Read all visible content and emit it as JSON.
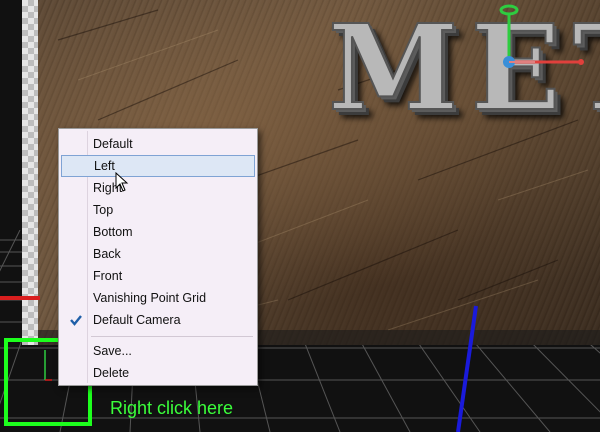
{
  "context_menu": {
    "items": [
      {
        "label": "Default",
        "checked": false,
        "hovered": false
      },
      {
        "label": "Left",
        "checked": false,
        "hovered": true
      },
      {
        "label": "Right",
        "checked": false,
        "hovered": false
      },
      {
        "label": "Top",
        "checked": false,
        "hovered": false
      },
      {
        "label": "Bottom",
        "checked": false,
        "hovered": false
      },
      {
        "label": "Back",
        "checked": false,
        "hovered": false
      },
      {
        "label": "Front",
        "checked": false,
        "hovered": false
      },
      {
        "label": "Vanishing Point Grid",
        "checked": false,
        "hovered": false
      },
      {
        "label": "Default Camera",
        "checked": true,
        "hovered": false
      }
    ],
    "footer_items": [
      {
        "label": "Save..."
      },
      {
        "label": "Delete"
      }
    ]
  },
  "scene": {
    "title_text": "METAL"
  },
  "annotation": {
    "hint": "Right click here",
    "highlight_color": "#1dff1d"
  },
  "colors": {
    "menu_hover_bg": "#dde7f5",
    "menu_hover_border": "#7fa3d4",
    "axis_red": "#d91e1e",
    "axis_green": "#2ecc40",
    "axis_blue": "#1a1adb"
  },
  "icons": {
    "check": "check-icon",
    "cursor": "mouse-cursor-icon",
    "gizmo": "transform-gizmo-icon"
  }
}
